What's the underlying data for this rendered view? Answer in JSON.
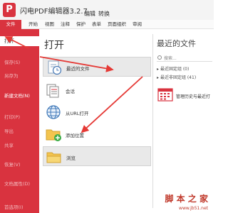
{
  "app": {
    "logo_letter": "P",
    "title": "闪电PDF编辑器3.2.7",
    "menu": [
      "编辑",
      "转换"
    ]
  },
  "tabs": {
    "file": "文件",
    "items": [
      "开始",
      "视图",
      "注释",
      "保护",
      "表单",
      "页面组织",
      "审阅"
    ]
  },
  "sidebar": {
    "open": "打开",
    "items": [
      "保存(S)",
      "另存为",
      "新建文档(N)",
      "打印(P)",
      "导出",
      "共享",
      "恢复(V)",
      "文档属性(D)",
      "首选项(I)"
    ]
  },
  "middle": {
    "title": "打开",
    "options": [
      {
        "label": "最近的文件",
        "icon": "recent-files-icon"
      },
      {
        "label": "会话",
        "icon": "session-icon"
      },
      {
        "label": "从URL打开",
        "icon": "url-globe-icon"
      },
      {
        "label": "添加位置",
        "icon": "add-location-icon"
      },
      {
        "label": "浏览",
        "icon": "browse-folder-icon"
      }
    ]
  },
  "right": {
    "title": "最近的文件",
    "search_placeholder": "搜索...",
    "group_pinned": "最近固定组 (0)",
    "group_unpinned": "最近非固定组 (41)",
    "manage_label": "管理历史与最近打"
  },
  "watermark": {
    "text": "脚 本 之 家",
    "url": "www.jb51.net"
  },
  "colors": {
    "accent": "#d9333f",
    "annotation_arrow": "#e53935"
  }
}
